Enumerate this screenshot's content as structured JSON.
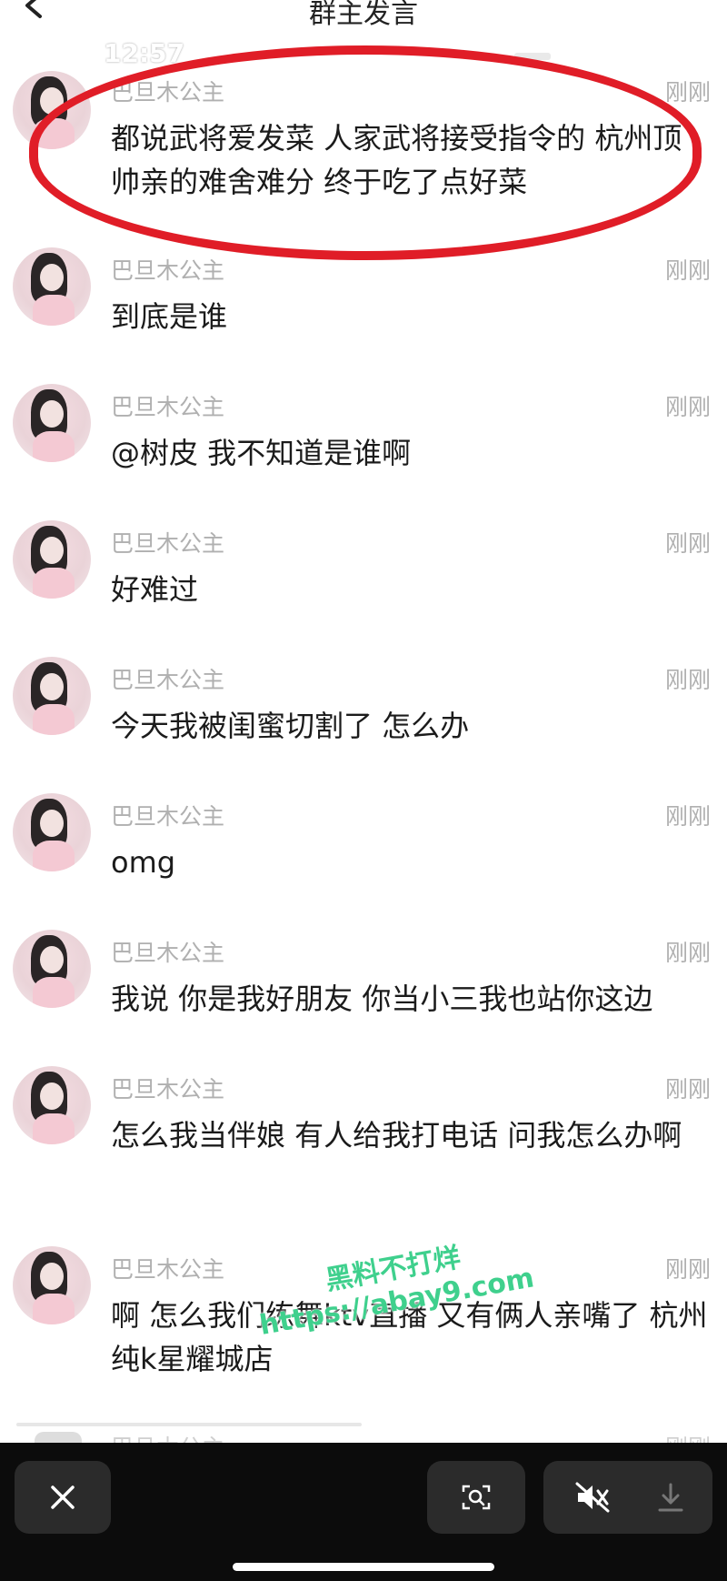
{
  "header": {
    "title": "群主发言",
    "status_time": "12:57"
  },
  "messages": [
    {
      "sender": "巴旦木公主",
      "time": "刚刚",
      "text": "都说武将爱发菜 人家武将接受指令的 杭州顶帅亲的难舍难分 终于吃了点好菜"
    },
    {
      "sender": "巴旦木公主",
      "time": "刚刚",
      "text": "到底是谁"
    },
    {
      "sender": "巴旦木公主",
      "time": "刚刚",
      "text": "@树皮 我不知道是谁啊"
    },
    {
      "sender": "巴旦木公主",
      "time": "刚刚",
      "text": "好难过"
    },
    {
      "sender": "巴旦木公主",
      "time": "刚刚",
      "text": "今天我被闺蜜切割了 怎么办"
    },
    {
      "sender": "巴旦木公主",
      "time": "刚刚",
      "text": "omg"
    },
    {
      "sender": "巴旦木公主",
      "time": "刚刚",
      "text": "我说 你是我好朋友 你当小三我也站你这边"
    },
    {
      "sender": "巴旦木公主",
      "time": "刚刚",
      "text": "怎么我当伴娘 有人给我打电话 问我怎么办啊"
    },
    {
      "sender": "巴旦木公主",
      "time": "刚刚",
      "text": "啊 怎么我们练舞ktv直播 又有俩人亲嘴了 杭州纯k星耀城店"
    }
  ],
  "partial_next": {
    "sender": "巴旦木公主",
    "time": "刚刚"
  },
  "watermark": {
    "line1": "黑料不打烊",
    "line2": "https://abay9.com"
  },
  "colors": {
    "highlight": "#e01d27",
    "watermark": "#3fd08d",
    "bottom_bar": "#0c0c0c"
  },
  "icons": {
    "back": "chevron-left-icon",
    "close": "close-icon",
    "scan": "scan-text-icon",
    "mute": "speaker-muted-icon",
    "download": "download-icon"
  }
}
